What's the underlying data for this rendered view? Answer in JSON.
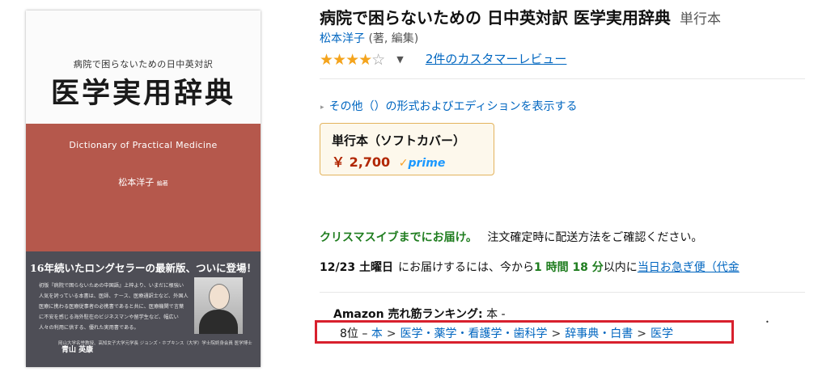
{
  "book": {
    "title": "病院で困らないための 日中英対訳 医学実用辞典",
    "binding": "単行本",
    "author_line": "松本洋子 (著, 編集)",
    "author_name": "松本洋子",
    "author_role": " (著, 編集)"
  },
  "rating": {
    "stars_filled": "★★★★",
    "stars_empty": "☆",
    "value": 4,
    "max": 5,
    "caret": "▼",
    "review_link": "2件のカスタマーレビュー"
  },
  "other_formats": {
    "label": "その他（）の形式およびエディションを表示する",
    "icon": "triangle-right-icon"
  },
  "format": {
    "name": "単行本（ソフトカバー）",
    "price": "￥ 2,700",
    "prime_check": "✓",
    "prime": "prime"
  },
  "delivery": {
    "promo": "クリスマスイブまでにお届け。",
    "note": "注文確定時に配送方法をご確認ください。",
    "date": "12/23 土曜日",
    "text_before": "にお届けするには、今から",
    "countdown": "1 時間 18 分",
    "text_after": "以内に",
    "service_link": "当日お急ぎ便（代金"
  },
  "ranking": {
    "label_bold": "Amazon 売れ筋ランキング:",
    "label_rest": " 本 -",
    "prefix": "8位 – ",
    "path": [
      "本",
      "医学・薬学・看護学・歯科学",
      "辞事典・白書",
      "医学"
    ],
    "separator": ">"
  },
  "cover": {
    "series": "病院で困らないための日中英対訳",
    "title": "医学実用辞典",
    "english_title": "Dictionary of Practical Medicine",
    "author": "松本洋子",
    "author_role": "編著",
    "catchcopy": "16年続いたロングセラーの最新版、ついに登場！",
    "blurb": "初版『病院で困らないための中国語』上梓より、いまだに根強い人気を誇っている本書は、医師、ナース、医療通訳士など、外国人医療に携わる医療従事者の必携書であると共に、医療機関で言葉に不安を感じる海外駐在のビジネスマンや留学生など、幅広い人々の利用に供する、優れた実用書である。",
    "recommender_org": "岡山大学名誉教授、高知女子大学元学長 ジョンズ・ホプキンス（大学）学士院終身会員",
    "recommender_role": "医学博士",
    "recommender_name": "青山 英康"
  },
  "colors": {
    "link": "#0066c0",
    "price": "#b12704",
    "green": "#1f7d1f",
    "star": "#f4a41d",
    "highlight_border": "#d8202d",
    "cover_band": "#b5584c",
    "cover_bottom": "#4e4e56"
  }
}
